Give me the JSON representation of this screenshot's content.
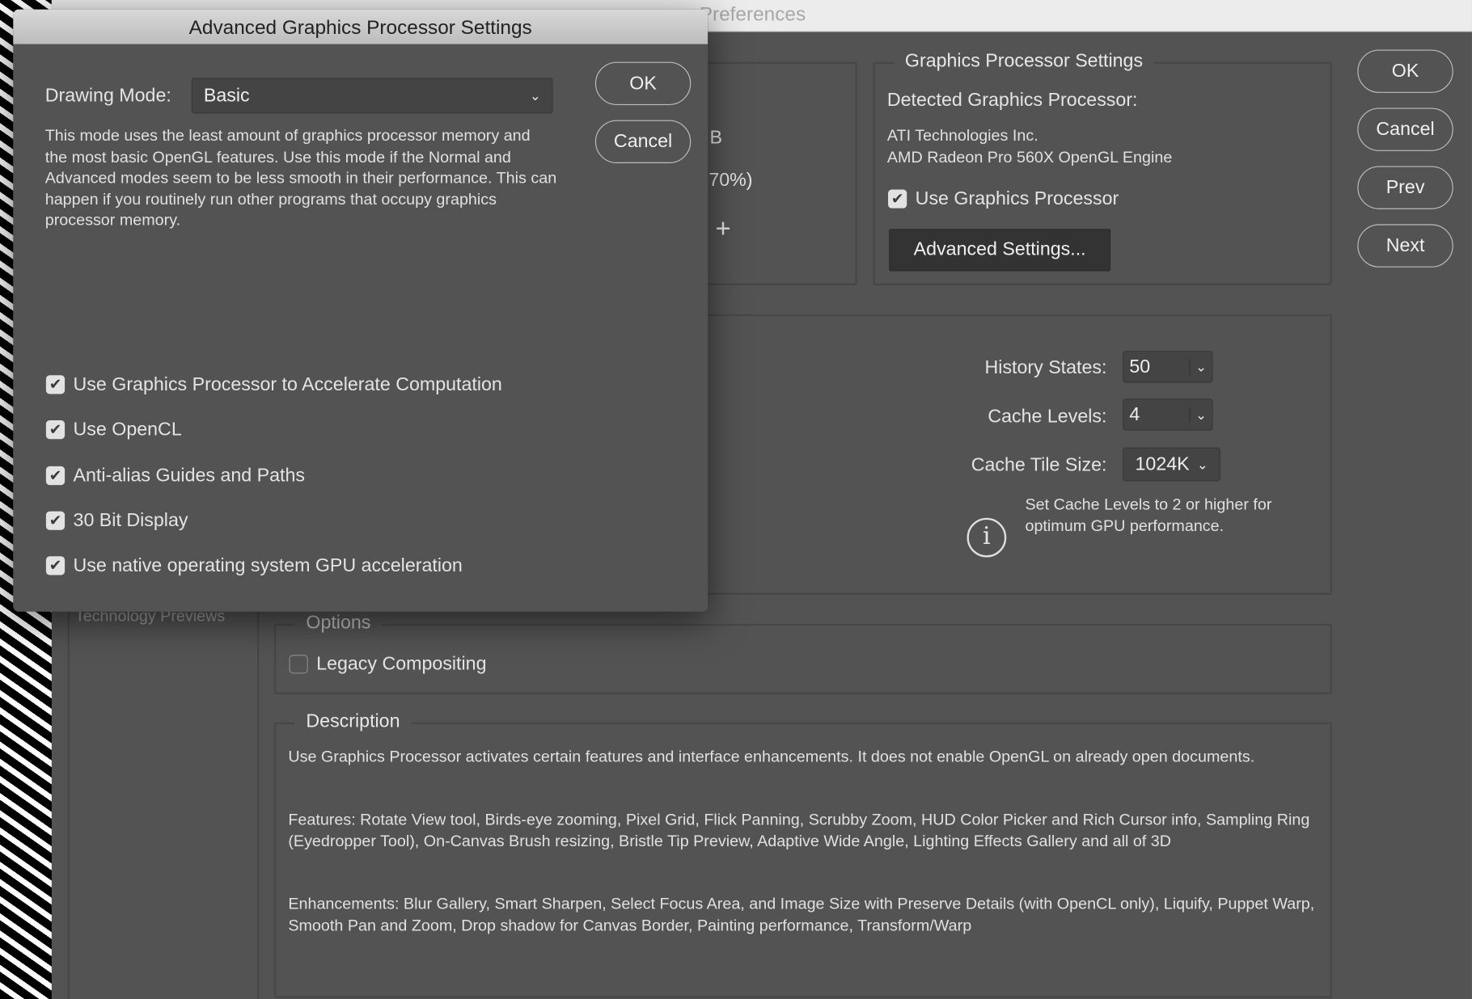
{
  "preferences": {
    "title": "Preferences",
    "sidebar": {
      "items": [
        {
          "label": "Technology Previews"
        }
      ]
    },
    "memory_fragments": {
      "unit": "B",
      "percent": "70%)",
      "plus": "+"
    },
    "gpu": {
      "legend": "Graphics Processor Settings",
      "detected_label": "Detected Graphics Processor:",
      "vendor": "ATI Technologies Inc.",
      "renderer": "AMD Radeon Pro 560X OpenGL Engine",
      "use_gpu_label": "Use Graphics Processor",
      "use_gpu_checked": true,
      "advanced_button": "Advanced Settings..."
    },
    "buttons": {
      "ok": "OK",
      "cancel": "Cancel",
      "prev": "Prev",
      "next": "Next"
    },
    "history": {
      "history_label": "History States:",
      "history_value": "50",
      "cache_levels_label": "Cache Levels:",
      "cache_levels_value": "4",
      "tile_label": "Cache Tile Size:",
      "tile_value": "1024K",
      "info_text": "Set Cache Levels to 2 or higher for optimum GPU performance.",
      "info_icon": "info-icon"
    },
    "options": {
      "legend": "Options",
      "legacy_label": "Legacy Compositing",
      "legacy_checked": false
    },
    "description": {
      "legend": "Description",
      "p1": "Use Graphics Processor activates certain features and interface enhancements. It does not enable OpenGL on already open documents.",
      "p2": "Features: Rotate View tool, Birds-eye zooming, Pixel Grid, Flick Panning, Scrubby Zoom, HUD Color Picker and Rich Cursor info, Sampling Ring (Eyedropper Tool), On-Canvas Brush resizing, Bristle Tip Preview, Adaptive Wide Angle, Lighting Effects Gallery and all of 3D",
      "p3": "Enhancements: Blur Gallery, Smart Sharpen, Select Focus Area, and Image Size with Preserve Details (with OpenCL only), Liquify, Puppet Warp, Smooth Pan and Zoom, Drop shadow for Canvas Border, Painting performance, Transform/Warp"
    }
  },
  "dialog": {
    "title": "Advanced Graphics Processor Settings",
    "drawing_mode_label": "Drawing Mode:",
    "drawing_mode_value": "Basic",
    "mode_description": "This mode uses the least amount of graphics processor memory and the most basic OpenGL features.  Use this mode if the Normal and Advanced modes seem to be less smooth in their performance.  This can happen if you routinely run other programs that occupy graphics processor memory.",
    "ok": "OK",
    "cancel": "Cancel",
    "checkboxes": [
      {
        "label": "Use Graphics Processor to Accelerate Computation",
        "checked": true
      },
      {
        "label": "Use OpenCL",
        "checked": true
      },
      {
        "label": "Anti-alias Guides and Paths",
        "checked": true
      },
      {
        "label": "30 Bit Display",
        "checked": true
      },
      {
        "label": "Use native operating system GPU acceleration",
        "checked": true
      }
    ]
  }
}
